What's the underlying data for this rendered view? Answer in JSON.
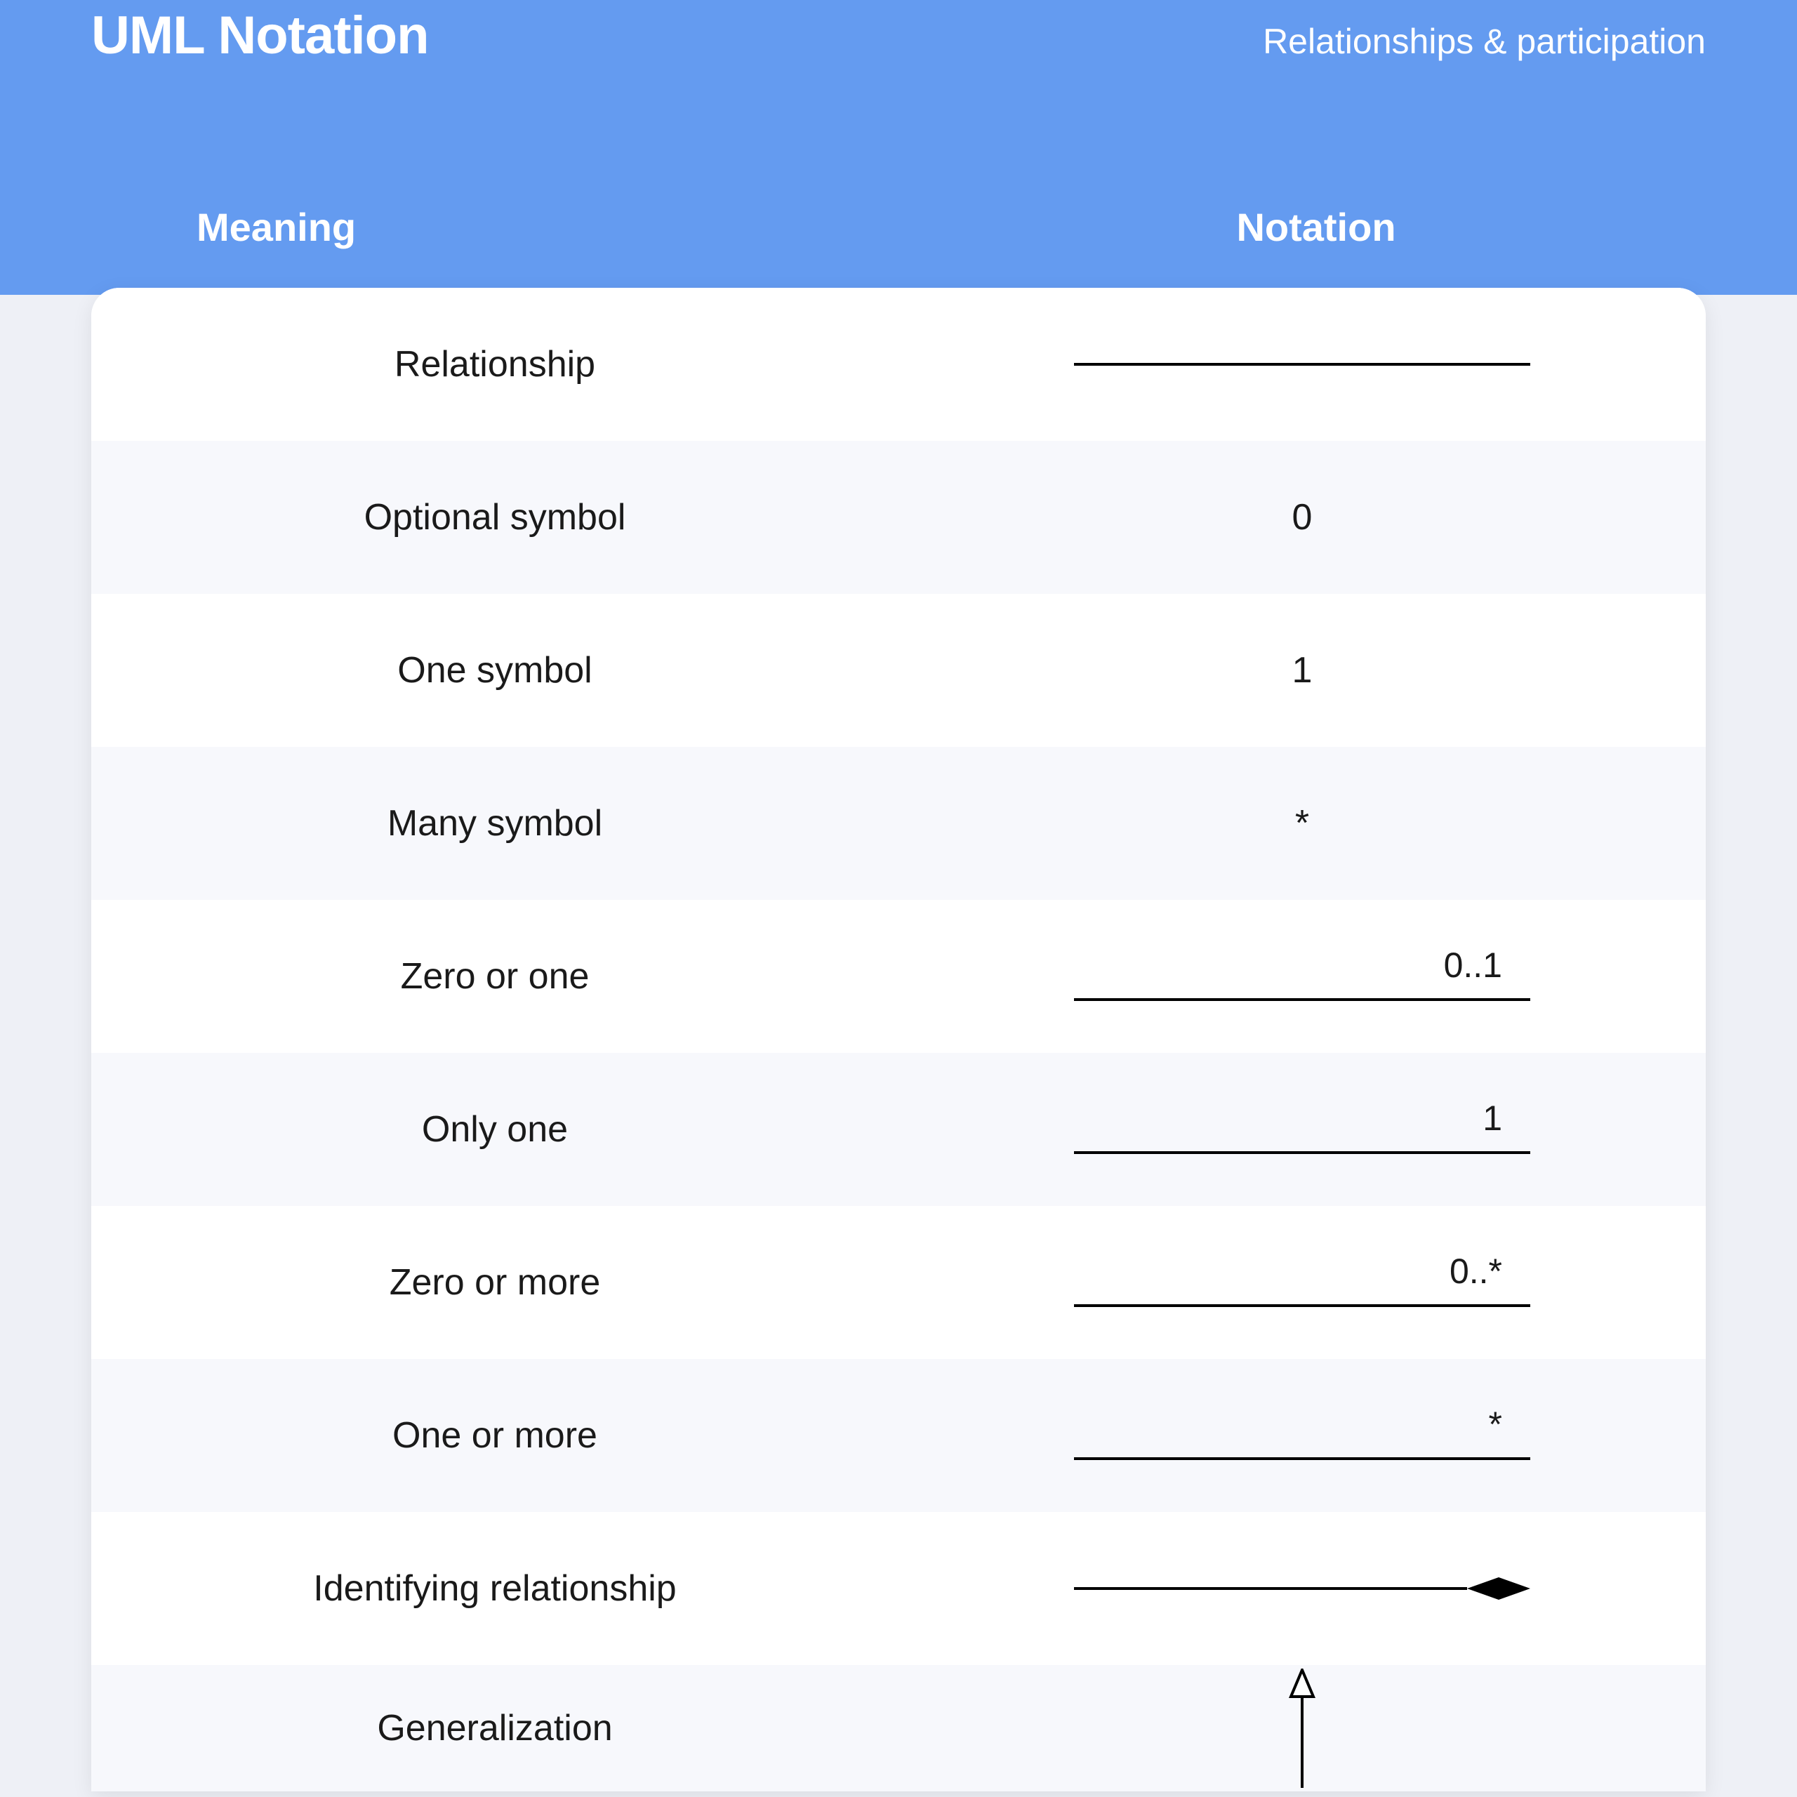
{
  "header": {
    "title": "UML Notation",
    "subtitle": "Relationships & participation",
    "col_meaning": "Meaning",
    "col_notation": "Notation"
  },
  "rows": [
    {
      "meaning": "Relationship",
      "type": "line"
    },
    {
      "meaning": "Optional symbol",
      "type": "text",
      "value": "0"
    },
    {
      "meaning": "One symbol",
      "type": "text",
      "value": "1"
    },
    {
      "meaning": "Many symbol",
      "type": "text",
      "value": "*"
    },
    {
      "meaning": "Zero or one",
      "type": "labeled-line",
      "value": "0..1"
    },
    {
      "meaning": "Only one",
      "type": "labeled-line",
      "value": "1"
    },
    {
      "meaning": "Zero or more",
      "type": "labeled-line",
      "value": "0..*"
    },
    {
      "meaning": "One or more",
      "type": "labeled-line",
      "value": "*"
    },
    {
      "meaning": "Identifying relationship",
      "type": "diamond-line"
    },
    {
      "meaning": "Generalization",
      "type": "arrow-up"
    }
  ]
}
